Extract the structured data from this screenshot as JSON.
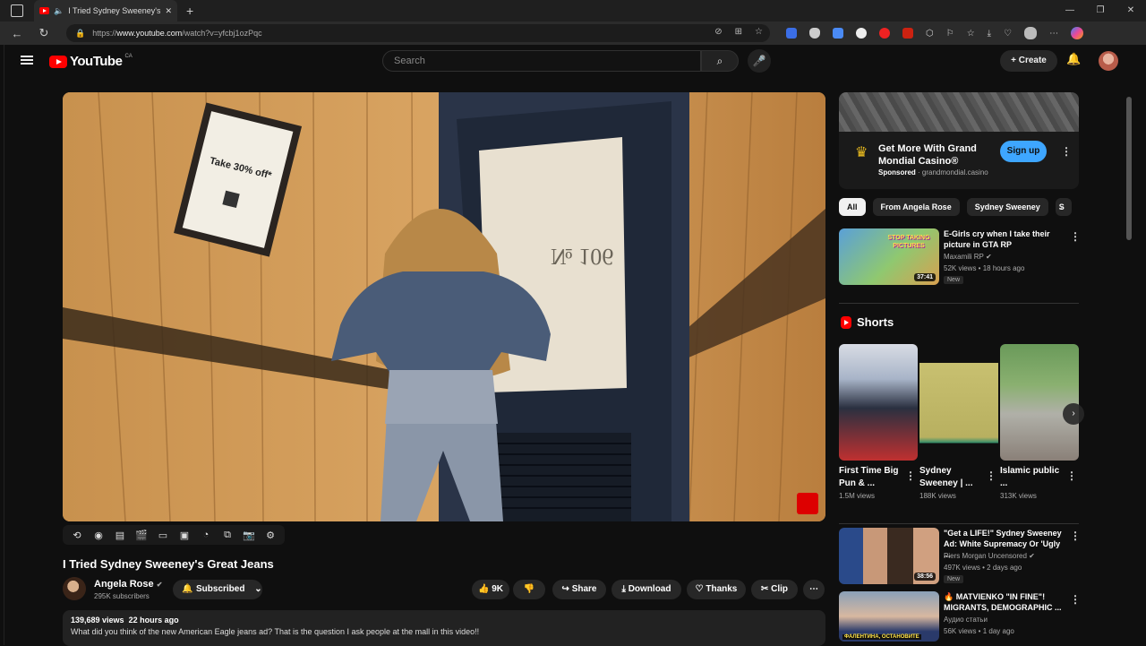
{
  "browser": {
    "tab_title": "I Tried Sydney Sweeney's Gre",
    "url_prefix": "https://",
    "url_host": "www.youtube.com",
    "url_path": "/watch?v=yfcbj1ozPqc",
    "window_controls": [
      "—",
      "❐",
      "✕"
    ]
  },
  "masthead": {
    "logo_text": "YouTube",
    "logo_country": "CA",
    "search_placeholder": "Search",
    "create_label": "Create"
  },
  "video": {
    "title": "I Tried Sydney Sweeney's Great Jeans",
    "overlay_sign_text": "Take 30% off*",
    "door_number": "№ 106"
  },
  "channel": {
    "name": "Angela Rose",
    "subscribers": "295K subscribers",
    "subscribed_label": "Subscribed"
  },
  "actions": {
    "likes": "9K",
    "share": "Share",
    "download": "Download",
    "thanks": "Thanks",
    "clip": "Clip"
  },
  "description": {
    "views": "139,689 views",
    "age": "22 hours ago",
    "text": "What did you think of the new American Eagle jeans ad? That is the question I ask people at the mall in this video!!"
  },
  "ad": {
    "title": "Get More With Grand Mondial Casino®",
    "sponsored": "Sponsored",
    "domain": "grandmondial.casino",
    "cta": "Sign up"
  },
  "chips": [
    "All",
    "From Angela Rose",
    "Sydney Sweeney",
    "S"
  ],
  "recommendations": [
    {
      "title": "E-Girls cry when I take their picture in GTA RP",
      "channel": "Maxamili RP",
      "views": "52K views • 18 hours ago",
      "badge": "New",
      "duration": "37:41",
      "thumb_text": "STOP TAKING PICTURES"
    },
    {
      "title": "\"Get a LIFE!\" Sydney Sweeney Ad: White Supremacy Or 'Ugly ...",
      "channel": "Piers Morgan Uncensored",
      "views": "497K views • 2 days ago",
      "badge": "New",
      "duration": "38:56",
      "thumb_text": ""
    },
    {
      "title": "🔥 MATVIENKO \"IN FINE\"! MIGRANTS, DEMOGRAPHIC ...",
      "channel": "Аудио статьи",
      "views": "56K views • 1 day ago",
      "badge": "",
      "duration": "",
      "thumb_text": "ФАЛЕНТИНА, ОСТАНОВИТЕ"
    }
  ],
  "shorts": {
    "heading": "Shorts",
    "items": [
      {
        "title": "First Time Big Pun & ...",
        "views": "1.5M views"
      },
      {
        "title": "Sydney Sweeney | ...",
        "views": "188K views"
      },
      {
        "title": "Islamic public ...",
        "views": "313K views"
      }
    ]
  },
  "colors": {
    "accent_red": "#ff0000",
    "signup_blue": "#3ea6ff",
    "bg": "#0f0f0f"
  }
}
